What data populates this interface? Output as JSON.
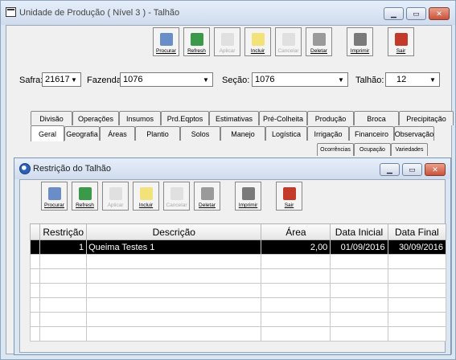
{
  "main_window": {
    "title": "Unidade de Produção ( Nível 3 ) - Talhão",
    "toolbar": [
      {
        "label": "Procurar",
        "icon": "search-icon",
        "enabled": true
      },
      {
        "label": "Refresh",
        "icon": "refresh-icon",
        "enabled": true
      },
      {
        "label": "Aplicar",
        "icon": "apply-icon",
        "enabled": false
      },
      {
        "label": "Incluir",
        "icon": "add-icon",
        "enabled": true
      },
      {
        "label": "Cancelar",
        "icon": "cancel-icon",
        "enabled": false
      },
      {
        "label": "Deletar",
        "icon": "trash-icon",
        "enabled": true
      },
      {
        "label": "Imprimir",
        "icon": "printer-icon",
        "enabled": true
      },
      {
        "label": "Sair",
        "icon": "exit-icon",
        "enabled": true
      }
    ],
    "filters": {
      "safra_label": "Safra:",
      "safra_value": "21617",
      "fazenda_label": "Fazenda",
      "fazenda_value": "1076",
      "secao_label": "Seção:",
      "secao_value": "1076",
      "talhao_label": "Talhão:",
      "talhao_value": "12"
    },
    "tabs_row1": [
      "Divisão",
      "Operações",
      "Insumos",
      "Prd.Eqptos",
      "Estimativas",
      "Pré-Colheita",
      "Produção",
      "Broca",
      "Precipitação"
    ],
    "tabs_row2": [
      "Geral",
      "Geografia",
      "Áreas",
      "Plantio",
      "Solos",
      "Manejo",
      "Logística",
      "Irrigação",
      "Financeiro",
      "Observação"
    ],
    "subtabs": [
      "Ocorrências",
      "Ocupação",
      "Variedades"
    ]
  },
  "child_window": {
    "title": "Restrição do Talhão",
    "toolbar": [
      {
        "label": "Procurar",
        "icon": "search-icon",
        "enabled": true
      },
      {
        "label": "Refresh",
        "icon": "refresh-icon",
        "enabled": true
      },
      {
        "label": "Aplicar",
        "icon": "apply-icon",
        "enabled": false
      },
      {
        "label": "Incluir",
        "icon": "add-icon",
        "enabled": true
      },
      {
        "label": "Cancelar",
        "icon": "cancel-icon",
        "enabled": false
      },
      {
        "label": "Deletar",
        "icon": "trash-icon",
        "enabled": true
      },
      {
        "label": "Imprimir",
        "icon": "printer-icon",
        "enabled": true
      },
      {
        "label": "Sair",
        "icon": "exit-icon",
        "enabled": true
      }
    ],
    "table": {
      "columns": [
        "Restrição",
        "Descrição",
        "Área",
        "Data Inicial",
        "Data Final"
      ],
      "rows": [
        [
          "1",
          "Queima Testes 1",
          "2,00",
          "01/09/2016",
          "30/09/2016"
        ]
      ]
    }
  },
  "colors": {
    "title_bg": "#dbe6f3",
    "selected_row": "#000000",
    "close_button": "#c9523b"
  }
}
